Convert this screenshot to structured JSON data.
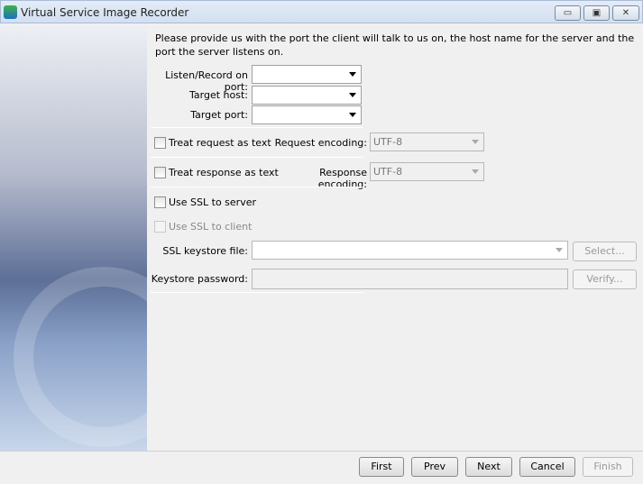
{
  "window": {
    "title": "Virtual Service Image Recorder",
    "minimize": "▭",
    "maximize": "▣",
    "close": "✕"
  },
  "instructions": "Please provide us with the port the client will talk to us on, the host name for the server and the port the server listens on.",
  "fields": {
    "listen_port_label": "Listen/Record on port:",
    "listen_port_value": "",
    "target_host_label": "Target host:",
    "target_host_value": "",
    "target_port_label": "Target port:",
    "target_port_value": ""
  },
  "request": {
    "checkbox_label": "Treat request as text",
    "checked": false,
    "encoding_label": "Request encoding:",
    "encoding_value": "UTF-8"
  },
  "response": {
    "checkbox_label": "Treat response as text",
    "checked": false,
    "encoding_label": "Response encoding:",
    "encoding_value": "UTF-8"
  },
  "ssl": {
    "server_label": "Use SSL to server",
    "client_label": "Use SSL to client",
    "keystore_label": "SSL keystore file:",
    "keystore_value": "",
    "select_button": "Select...",
    "password_label": "Keystore password:",
    "password_value": "",
    "verify_button": "Verify..."
  },
  "footer": {
    "first": "First",
    "prev": "Prev",
    "next": "Next",
    "cancel": "Cancel",
    "finish": "Finish"
  }
}
